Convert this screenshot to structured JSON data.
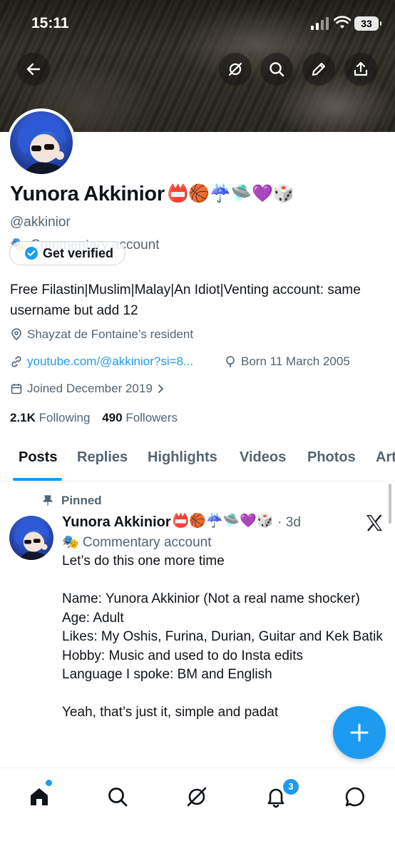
{
  "status_bar": {
    "time": "15:11",
    "battery": "33"
  },
  "profile": {
    "name": "Yunora Akkinior",
    "name_emojis": "📛🏀☔️🛸💜🎲",
    "handle": "@akkinior",
    "category": "🎭 Commentary account",
    "verify_label": "Get verified",
    "bio": "Free Filastin|Muslim|Malay|An Idiot|Venting account: same username but add 12",
    "location": "Shayzat de Fontaine’s resident",
    "website": "youtube.com/@akkinior?si=8...",
    "birthday": "Born 11 March 2005",
    "joined": "Joined December 2019",
    "following_count": "2.1K",
    "following_label": "Following",
    "followers_count": "490",
    "followers_label": "Followers"
  },
  "tabs": [
    "Posts",
    "Replies",
    "Highlights",
    "Videos",
    "Photos",
    "Art"
  ],
  "post": {
    "pinned_label": "Pinned",
    "author": "Yunora Akkinior",
    "author_emojis": "📛🏀☔️🛸💜🎲",
    "time": "· 3d",
    "category": "🎭 Commentary account",
    "body": "Let’s do this one more time\n\nName: Yunora Akkinior (Not a real name shocker)\nAge: Adult\nLikes: My Oshis, Furina, Durian, Guitar and Kek Batik\nHobby: Music and used to do Insta edits\nLanguage I spoke: BM and English\n\nYeah, that’s just it, simple and padat"
  },
  "nav": {
    "notifications_badge": "3"
  },
  "colors": {
    "accent": "#1d9bf0",
    "text": "#0f1419",
    "muted": "#536471"
  },
  "icons": [
    "back-arrow-icon",
    "grok-icon",
    "search-icon",
    "edit-icon",
    "share-icon",
    "verified-badge-icon",
    "location-icon",
    "link-icon",
    "balloon-icon",
    "calendar-icon",
    "chevron-right-icon",
    "pin-icon",
    "x-logo-icon",
    "plus-icon",
    "home-icon",
    "notifications-icon",
    "messages-icon"
  ]
}
